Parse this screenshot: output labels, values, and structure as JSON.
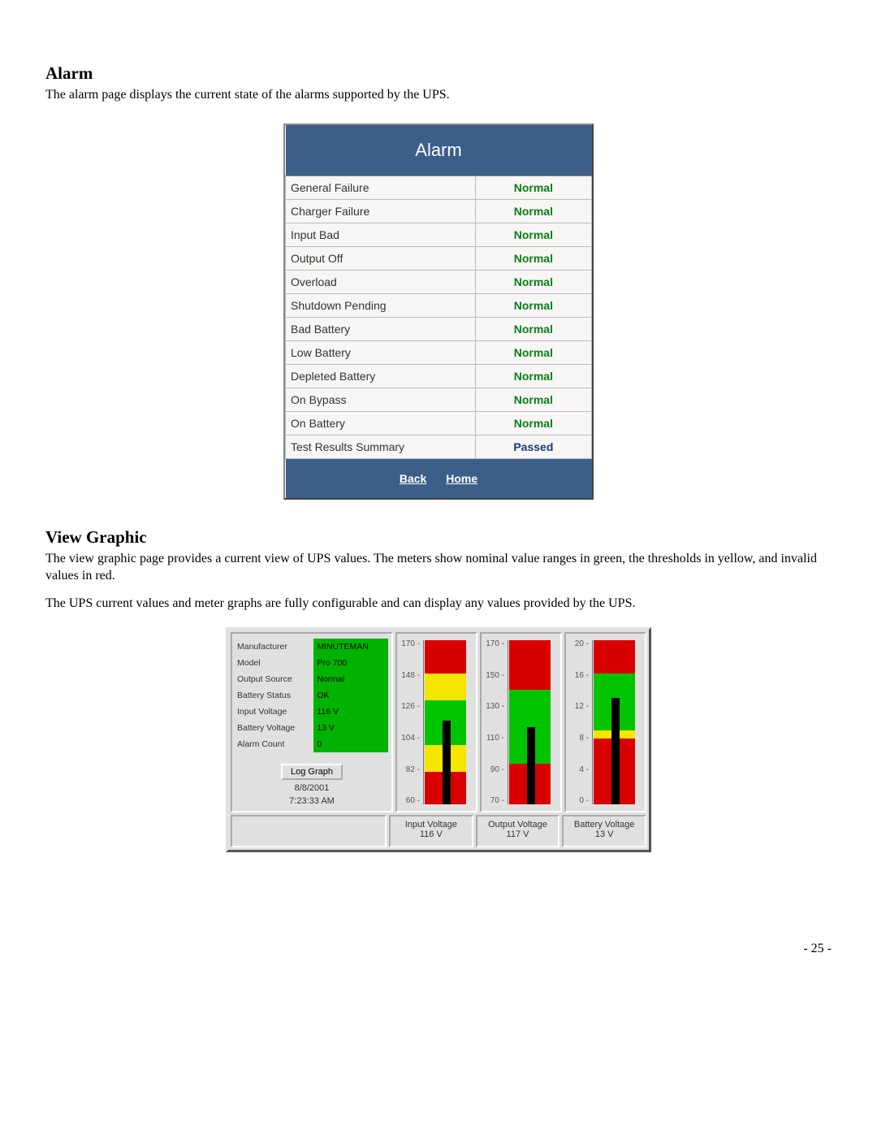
{
  "sections": {
    "alarm": {
      "heading": "Alarm",
      "description": "The alarm page displays the current state of the alarms supported by the UPS."
    },
    "view_graphic": {
      "heading": "View Graphic",
      "description1": "The view graphic page provides a current view of UPS values.  The meters show nominal value ranges in green, the thresholds in yellow, and invalid values in red.",
      "description2": "The UPS current values and meter graphs are fully configurable and can display any values provided by the UPS."
    }
  },
  "alarm_table": {
    "title": "Alarm",
    "rows": [
      {
        "label": "General Failure",
        "status": "Normal"
      },
      {
        "label": "Charger Failure",
        "status": "Normal"
      },
      {
        "label": "Input Bad",
        "status": "Normal"
      },
      {
        "label": "Output Off",
        "status": "Normal"
      },
      {
        "label": "Overload",
        "status": "Normal"
      },
      {
        "label": "Shutdown Pending",
        "status": "Normal"
      },
      {
        "label": "Bad Battery",
        "status": "Normal"
      },
      {
        "label": "Low Battery",
        "status": "Normal"
      },
      {
        "label": "Depleted Battery",
        "status": "Normal"
      },
      {
        "label": "On Bypass",
        "status": "Normal"
      },
      {
        "label": "On Battery",
        "status": "Normal"
      },
      {
        "label": "Test Results Summary",
        "status": "Passed",
        "passed": true
      }
    ],
    "footer": {
      "back": "Back",
      "home": "Home"
    }
  },
  "graphic": {
    "info": [
      {
        "label": "Manufacturer",
        "value": "MINUTEMAN"
      },
      {
        "label": "Model",
        "value": "Pro 700"
      },
      {
        "label": "Output Source",
        "value": "Normal"
      },
      {
        "label": "Battery Status",
        "value": "OK"
      },
      {
        "label": "Input Voltage",
        "value": "116 V"
      },
      {
        "label": "Battery Voltage",
        "value": "13 V"
      },
      {
        "label": "Alarm Count",
        "value": "0"
      }
    ],
    "log_button": "Log Graph",
    "date": "8/8/2001",
    "time": "7:23:33 AM",
    "meters": [
      {
        "title": "Input Voltage",
        "reading": "116 V"
      },
      {
        "title": "Output Voltage",
        "reading": "117 V"
      },
      {
        "title": "Battery Voltage",
        "reading": "13 V"
      }
    ]
  },
  "chart_data": [
    {
      "type": "bar",
      "title": "Input Voltage",
      "ylabel": "",
      "ticks": [
        170,
        148,
        126,
        104,
        82,
        60
      ],
      "ylim": [
        60,
        170
      ],
      "zones": [
        {
          "range": [
            60,
            82
          ],
          "color": "red"
        },
        {
          "range": [
            82,
            100
          ],
          "color": "yellow"
        },
        {
          "range": [
            100,
            130
          ],
          "color": "green"
        },
        {
          "range": [
            130,
            148
          ],
          "color": "yellow"
        },
        {
          "range": [
            148,
            170
          ],
          "color": "red"
        }
      ],
      "value": 116,
      "value_label": "116 V"
    },
    {
      "type": "bar",
      "title": "Output Voltage",
      "ylabel": "",
      "ticks": [
        170,
        150,
        130,
        110,
        90,
        70
      ],
      "ylim": [
        70,
        170
      ],
      "zones": [
        {
          "range": [
            70,
            95
          ],
          "color": "red"
        },
        {
          "range": [
            95,
            140
          ],
          "color": "green"
        },
        {
          "range": [
            140,
            170
          ],
          "color": "red"
        }
      ],
      "value": 117,
      "value_label": "117 V"
    },
    {
      "type": "bar",
      "title": "Battery Voltage",
      "ylabel": "",
      "ticks": [
        20,
        16,
        12,
        8,
        4,
        0
      ],
      "ylim": [
        0,
        20
      ],
      "zones": [
        {
          "range": [
            0,
            8
          ],
          "color": "red"
        },
        {
          "range": [
            8,
            9
          ],
          "color": "yellow"
        },
        {
          "range": [
            9,
            16
          ],
          "color": "green"
        },
        {
          "range": [
            16,
            20
          ],
          "color": "red"
        }
      ],
      "value": 13,
      "value_label": "13 V"
    }
  ],
  "page_number": "- 25 -"
}
